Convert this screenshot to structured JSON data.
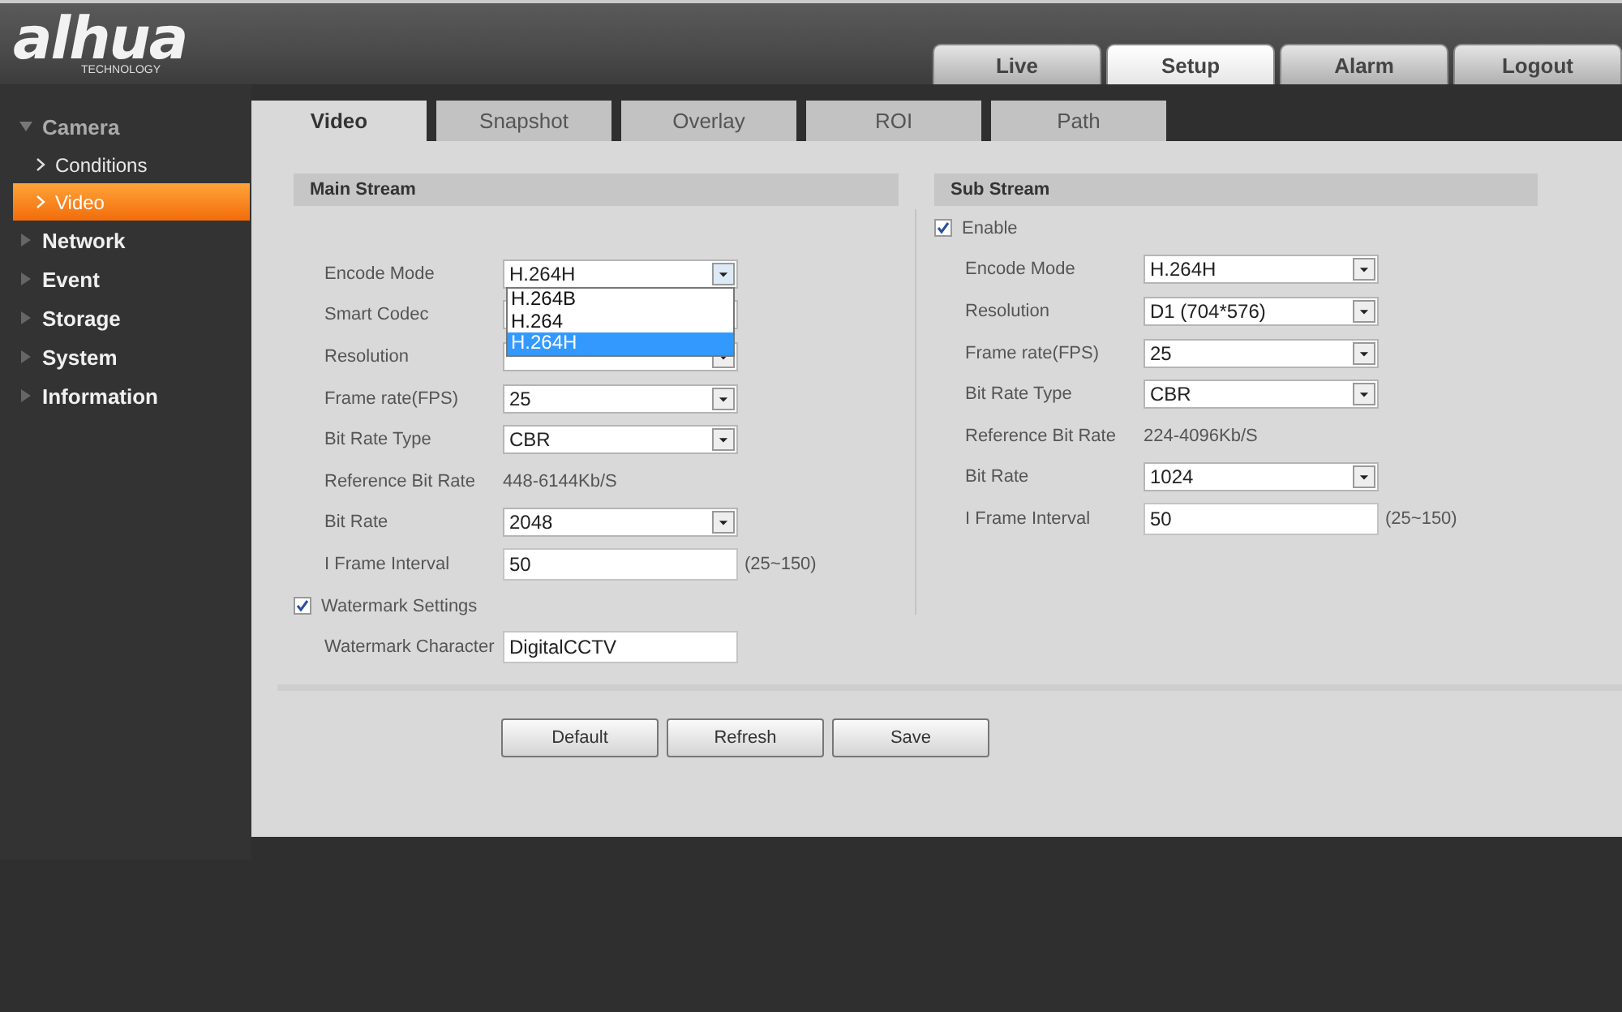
{
  "logo": {
    "name": "alhua",
    "tagline": "TECHNOLOGY"
  },
  "top_tabs": [
    {
      "label": "Live",
      "selected": false
    },
    {
      "label": "Setup",
      "selected": true
    },
    {
      "label": "Alarm",
      "selected": false
    },
    {
      "label": "Logout",
      "selected": false
    }
  ],
  "sidebar": {
    "items": [
      {
        "label": "Camera",
        "expanded": true,
        "children": [
          {
            "label": "Conditions",
            "selected": false
          },
          {
            "label": "Video",
            "selected": true
          }
        ]
      },
      {
        "label": "Network",
        "expanded": false
      },
      {
        "label": "Event",
        "expanded": false
      },
      {
        "label": "Storage",
        "expanded": false
      },
      {
        "label": "System",
        "expanded": false
      },
      {
        "label": "Information",
        "expanded": false
      }
    ]
  },
  "sub_tabs": [
    {
      "label": "Video",
      "selected": true
    },
    {
      "label": "Snapshot",
      "selected": false
    },
    {
      "label": "Overlay",
      "selected": false
    },
    {
      "label": "ROI",
      "selected": false
    },
    {
      "label": "Path",
      "selected": false
    }
  ],
  "main_stream": {
    "title": "Main Stream",
    "rows": [
      {
        "kind": "select",
        "label": "Encode Mode",
        "value": "H.264H",
        "open": true,
        "options": [
          {
            "label": "H.264B",
            "selected": false
          },
          {
            "label": "H.264",
            "selected": false
          },
          {
            "label": "H.264H",
            "selected": true
          }
        ]
      },
      {
        "kind": "select",
        "label": "Smart Codec"
      },
      {
        "kind": "select",
        "label": "Resolution"
      },
      {
        "kind": "select",
        "label": "Frame rate(FPS)",
        "value": "25"
      },
      {
        "kind": "select",
        "label": "Bit Rate Type",
        "value": "CBR"
      },
      {
        "kind": "text",
        "label": "Reference Bit Rate",
        "value": "448-6144Kb/S"
      },
      {
        "kind": "select",
        "label": "Bit Rate",
        "value": "2048"
      },
      {
        "kind": "input",
        "label": "I Frame Interval",
        "value": "50",
        "hint": "(25~150)"
      },
      {
        "kind": "checkbox",
        "label": "Watermark Settings",
        "checked": true
      },
      {
        "kind": "input",
        "label": "Watermark Character",
        "value": "DigitalCCTV"
      }
    ]
  },
  "sub_stream": {
    "title": "Sub Stream",
    "rows": [
      {
        "kind": "checkbox",
        "label": "Enable",
        "checked": true
      },
      {
        "kind": "select",
        "label": "Encode Mode",
        "value": "H.264H"
      },
      {
        "kind": "select",
        "label": "Resolution",
        "value": "D1 (704*576)"
      },
      {
        "kind": "select",
        "label": "Frame rate(FPS)",
        "value": "25"
      },
      {
        "kind": "select",
        "label": "Bit Rate Type",
        "value": "CBR"
      },
      {
        "kind": "text",
        "label": "Reference Bit Rate",
        "value": "224-4096Kb/S"
      },
      {
        "kind": "select",
        "label": "Bit Rate",
        "value": "1024"
      },
      {
        "kind": "input",
        "label": "I Frame Interval",
        "value": "50",
        "hint": "(25~150)"
      }
    ]
  },
  "buttons": [
    "Default",
    "Refresh",
    "Save"
  ]
}
